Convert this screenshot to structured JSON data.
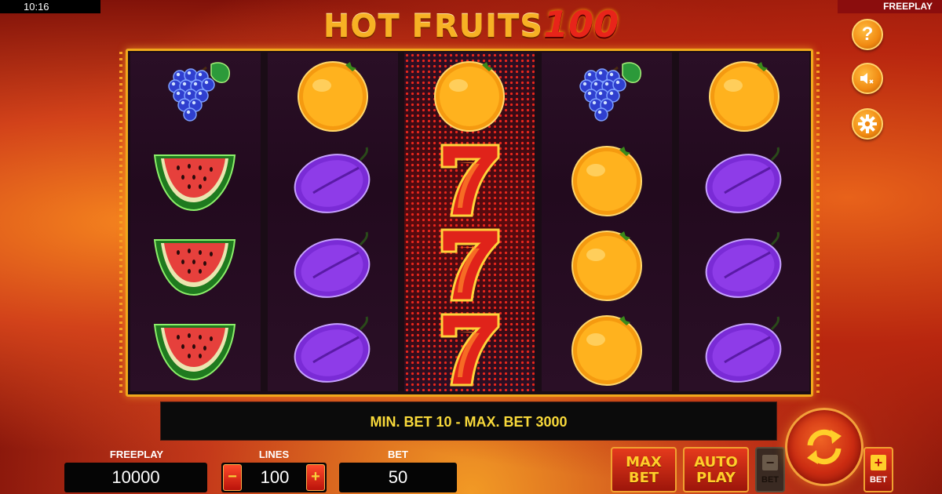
{
  "status_bar": {
    "time": "10:16",
    "mode": "FREEPLAY"
  },
  "logo": {
    "text": "HOT FRUITS",
    "number": "100"
  },
  "side_buttons": [
    {
      "icon": "help-icon",
      "label": "?"
    },
    {
      "icon": "sound-muted-icon"
    },
    {
      "icon": "settings-gear-icon"
    }
  ],
  "reels": [
    [
      "grapes",
      "watermelon",
      "watermelon",
      "watermelon"
    ],
    [
      "orange",
      "plum",
      "plum",
      "plum"
    ],
    [
      "orange",
      "seven",
      "seven",
      "seven"
    ],
    [
      "grapes",
      "orange",
      "orange",
      "orange"
    ],
    [
      "orange",
      "plum",
      "plum",
      "plum"
    ]
  ],
  "info": {
    "message": "MIN. BET 10 - MAX. BET 3000"
  },
  "balance": {
    "label": "FREEPLAY",
    "value": "10000"
  },
  "lines": {
    "label": "LINES",
    "value": "100",
    "minus": "−",
    "plus": "+"
  },
  "bet": {
    "label": "BET",
    "value": "50"
  },
  "buttons": {
    "max_bet_line1": "MAX",
    "max_bet_line2": "BET",
    "auto_play_line1": "AUTO",
    "auto_play_line2": "PLAY",
    "bet_minus_sign": "−",
    "bet_minus_label": "BET",
    "bet_plus_sign": "+",
    "bet_plus_label": "BET"
  },
  "colors": {
    "accent_gold": "#f0a81c",
    "message_yellow": "#f8d93a",
    "button_red": "#c8200f"
  }
}
